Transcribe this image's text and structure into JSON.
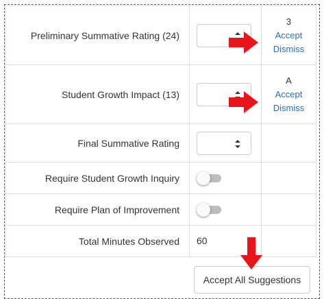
{
  "rows": [
    {
      "label": "Preliminary Summative Rating (24)",
      "suggestion": "3",
      "accept": "Accept",
      "dismiss": "Dismiss"
    },
    {
      "label": "Student Growth Impact (13)",
      "suggestion": "A",
      "accept": "Accept",
      "dismiss": "Dismiss"
    },
    {
      "label": "Final Summative Rating"
    },
    {
      "label": "Require Student Growth Inquiry",
      "toggle_on": false
    },
    {
      "label": "Require Plan of Improvement",
      "toggle_on": false
    },
    {
      "label": "Total Minutes Observed",
      "value": "60"
    }
  ],
  "accept_all_label": "Accept All Suggestions",
  "colors": {
    "link": "#1f6fc5",
    "arrow": "#e8161a",
    "border": "#dddddd",
    "text": "#333333"
  },
  "icons": {
    "select_caret": "chevron-up-down-icon",
    "annotation": "red-arrow-icon"
  }
}
